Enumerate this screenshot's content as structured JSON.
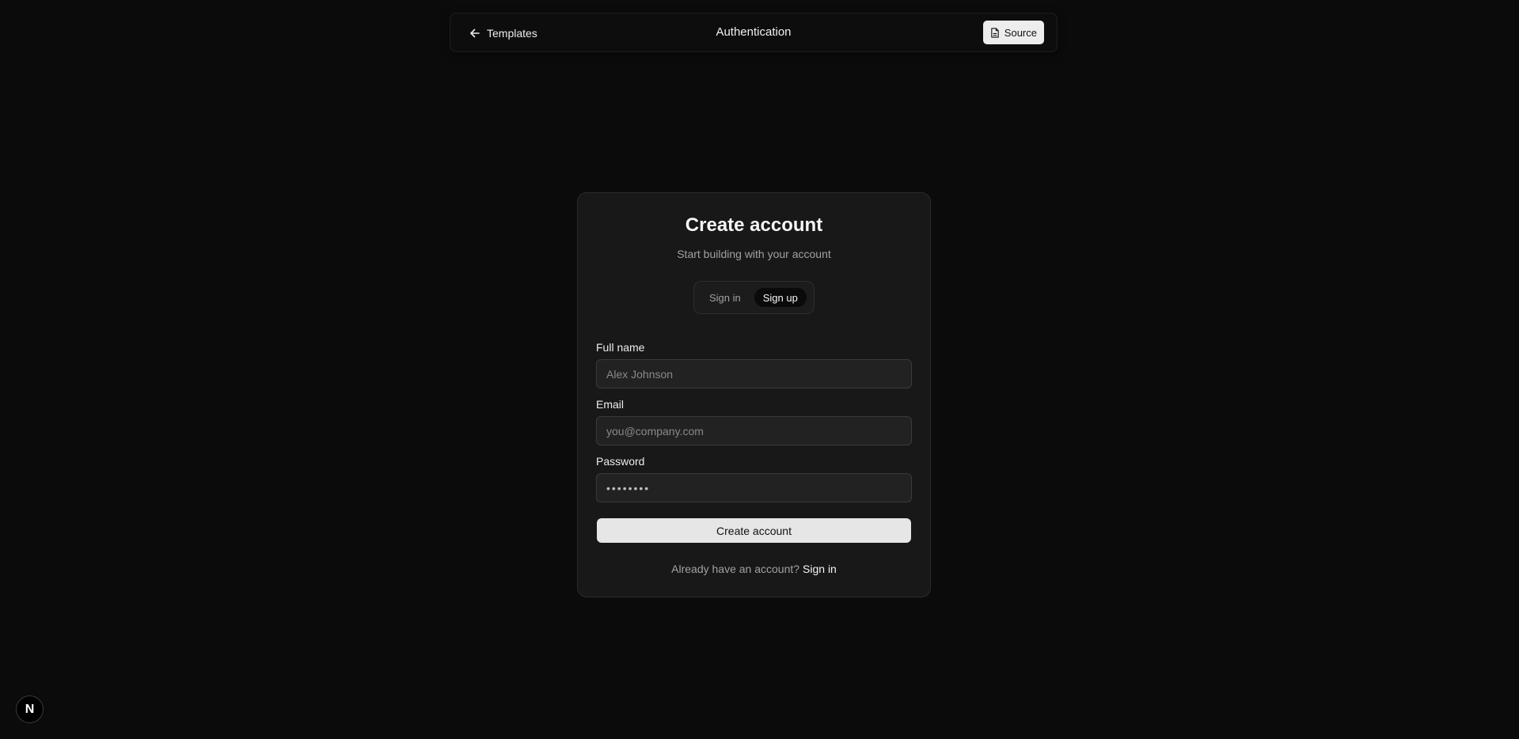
{
  "topbar": {
    "back_label": "Templates",
    "title": "Authentication",
    "source_label": "Source"
  },
  "card": {
    "title": "Create account",
    "subtitle": "Start building with your account",
    "tabs": [
      {
        "label": "Sign in",
        "active": false
      },
      {
        "label": "Sign up",
        "active": true
      }
    ],
    "fields": {
      "full_name": {
        "label": "Full name",
        "placeholder": "Alex Johnson",
        "value": ""
      },
      "email": {
        "label": "Email",
        "placeholder": "you@company.com",
        "value": ""
      },
      "password": {
        "label": "Password",
        "value": "••••••••"
      }
    },
    "submit_label": "Create account",
    "footer": {
      "prompt": "Already have an account?",
      "link": "Sign in"
    }
  },
  "badge": {
    "letter": "N"
  },
  "icons": {
    "back": "arrow-left-icon",
    "source": "file-icon"
  },
  "colors": {
    "background": "#0b0b0b",
    "card": "#181818",
    "button": "#e6e6e6",
    "muted_text": "#a1a1a1"
  }
}
